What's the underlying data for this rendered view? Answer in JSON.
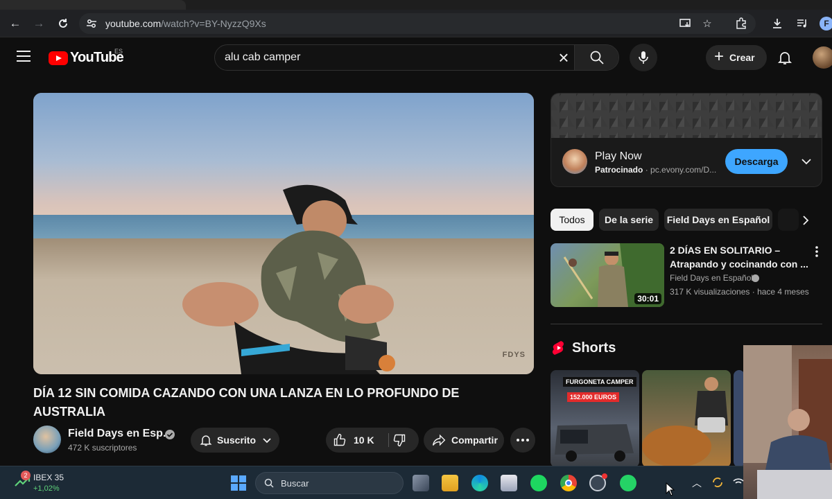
{
  "browser": {
    "url_host": "youtube.com",
    "url_path": "/watch?v=BY-NyzzQ9Xs",
    "profile_initial": "F"
  },
  "masthead": {
    "logo_text": "YouTube",
    "region": "ES",
    "search_value": "alu cab camper",
    "create_label": "Crear"
  },
  "video": {
    "title": "DÍA 12 SIN COMIDA CAZANDO CON UNA LANZA EN LO PROFUNDO DE AUSTRALIA",
    "watermark": "FDYS",
    "channel_name": "Field Days en Esp...",
    "subscribers": "472 K suscriptores",
    "subscribed_label": "Suscrito",
    "likes": "10 K",
    "share_label": "Compartir"
  },
  "ad": {
    "title": "Play Now",
    "sponsored": "Patrocinado",
    "domain": "pc.evony.com/D...",
    "cta": "Descarga"
  },
  "chips": [
    "Todos",
    "De la serie",
    "Field Days en Español"
  ],
  "recommendation": {
    "title": "2 DÍAS EN SOLITARIO – Atrapando y cocinando con ...",
    "channel": "Field Days en Español",
    "stats": "317 K visualizaciones · hace 4 meses",
    "duration": "30:01"
  },
  "shorts": {
    "title": "Shorts",
    "short1_line1": "FURGONETA CAMPER",
    "short1_line2": "152.000 EUROS"
  },
  "taskbar": {
    "ticker_name": "IBEX 35",
    "ticker_change": "+1,02%",
    "notification_count": "2",
    "search_placeholder": "Buscar"
  },
  "colors": {
    "youtube_red": "#ff0000",
    "accent_blue": "#3ea6ff",
    "positive_green": "#5fd37a"
  }
}
